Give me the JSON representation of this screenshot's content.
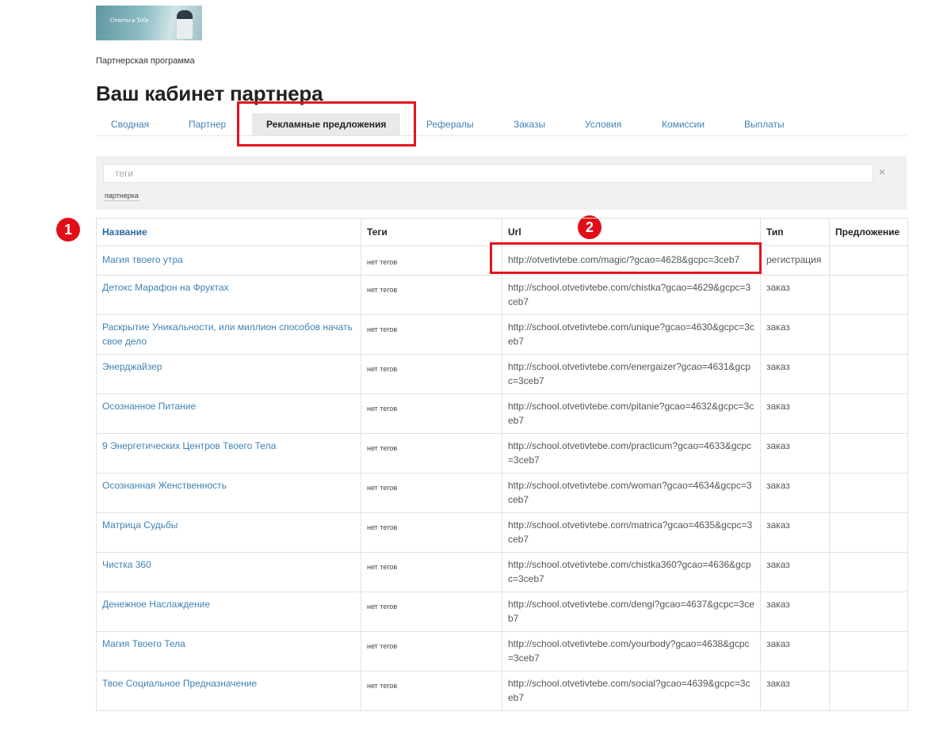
{
  "logo": {
    "text": "Ответы в Тебе"
  },
  "breadcrumb": "Партнерская программа",
  "page_title": "Ваш кабинет партнера",
  "tabs": [
    {
      "label": "Сводная"
    },
    {
      "label": "Партнер"
    },
    {
      "label": "Рекламные предложения",
      "active": true
    },
    {
      "label": "Рефералы"
    },
    {
      "label": "Заказы"
    },
    {
      "label": "Условия"
    },
    {
      "label": "Комиссии"
    },
    {
      "label": "Выплаты"
    }
  ],
  "filter": {
    "placeholder": "теги",
    "clear": "×",
    "tag": "партнерка"
  },
  "annotations": {
    "marker_1": "1",
    "marker_2": "2"
  },
  "table": {
    "headers": [
      "Название",
      "Теги",
      "Url",
      "Тип",
      "Предложение"
    ],
    "rows": [
      {
        "name": "Магия твоего утра",
        "tags": "нет тегов",
        "url": "http://otvetivtebe.com/magic/?gcao=4628&gcpc=3ceb7",
        "type": "регистрация",
        "offer": ""
      },
      {
        "name": "Детокс Марафон на Фруктах",
        "tags": "нет тегов",
        "url": "http://school.otvetivtebe.com/chistka?gcao=4629&gcpc=3ceb7",
        "type": "заказ",
        "offer": ""
      },
      {
        "name": "Раскрытие Уникальности, или миллион способов начать свое дело",
        "tags": "нет тегов",
        "url": "http://school.otvetivtebe.com/unique?gcao=4630&gcpc=3ceb7",
        "type": "заказ",
        "offer": ""
      },
      {
        "name": "Энерджайзер",
        "tags": "нет тегов",
        "url": "http://school.otvetivtebe.com/energaizer?gcao=4631&gcpc=3ceb7",
        "type": "заказ",
        "offer": ""
      },
      {
        "name": "Осознанное Питание",
        "tags": "нет тегов",
        "url": "http://school.otvetivtebe.com/pitanie?gcao=4632&gcpc=3ceb7",
        "type": "заказ",
        "offer": ""
      },
      {
        "name": "9 Энергетических Центров Твоего Тела",
        "tags": "нет тегов",
        "url": "http://school.otvetivtebe.com/practicum?gcao=4633&gcpc=3ceb7",
        "type": "заказ",
        "offer": ""
      },
      {
        "name": "Осознанная Женственность",
        "tags": "нет тегов",
        "url": "http://school.otvetivtebe.com/woman?gcao=4634&gcpc=3ceb7",
        "type": "заказ",
        "offer": ""
      },
      {
        "name": "Матрица Судьбы",
        "tags": "нет тегов",
        "url": "http://school.otvetivtebe.com/matrica?gcao=4635&gcpc=3ceb7",
        "type": "заказ",
        "offer": ""
      },
      {
        "name": "Чистка 360",
        "tags": "нет тегов",
        "url": "http://school.otvetivtebe.com/chistka360?gcao=4636&gcpc=3ceb7",
        "type": "заказ",
        "offer": ""
      },
      {
        "name": "Денежное Наслаждение",
        "tags": "нет тегов",
        "url": "http://school.otvetivtebe.com/dengi?gcao=4637&gcpc=3ceb7",
        "type": "заказ",
        "offer": ""
      },
      {
        "name": "Магия Твоего Тела",
        "tags": "нет тегов",
        "url": "http://school.otvetivtebe.com/yourbody?gcao=4638&gcpc=3ceb7",
        "type": "заказ",
        "offer": ""
      },
      {
        "name": "Твое Социальное Предназначение",
        "tags": "нет тегов",
        "url": "http://school.otvetivtebe.com/social?gcao=4639&gcpc=3ceb7",
        "type": "заказ",
        "offer": ""
      }
    ]
  },
  "colors": {
    "link": "#3f82b4",
    "annotation_red": "#e2141d",
    "active_tab_bg": "#e9e9e9"
  }
}
